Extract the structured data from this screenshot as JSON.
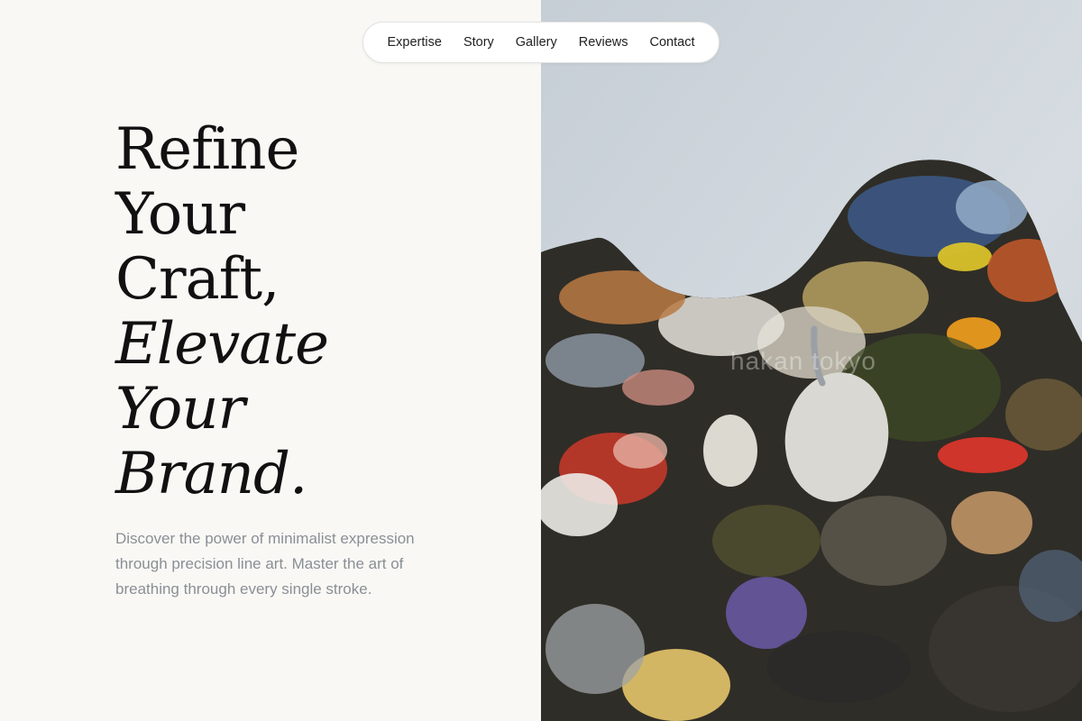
{
  "nav": {
    "items": [
      {
        "label": "Expertise"
      },
      {
        "label": "Story"
      },
      {
        "label": "Gallery"
      },
      {
        "label": "Reviews"
      },
      {
        "label": "Contact"
      }
    ]
  },
  "hero": {
    "headline_line1": "Refine",
    "headline_line2": "Your",
    "headline_line3": "Craft,",
    "headline_line4": "Elevate",
    "headline_line5": "Your",
    "headline_line6": "Brand.",
    "description": "Discover the power of minimalist expression through precision line art. Master the art of breathing through every single stroke."
  },
  "image": {
    "watermark": "hakan tokyo",
    "subject": "paint-palette-photo"
  },
  "colors": {
    "page_background": "#f9f8f5",
    "headline": "#111111",
    "body_text": "#8a8f95",
    "wall": "#cfd6dc"
  }
}
